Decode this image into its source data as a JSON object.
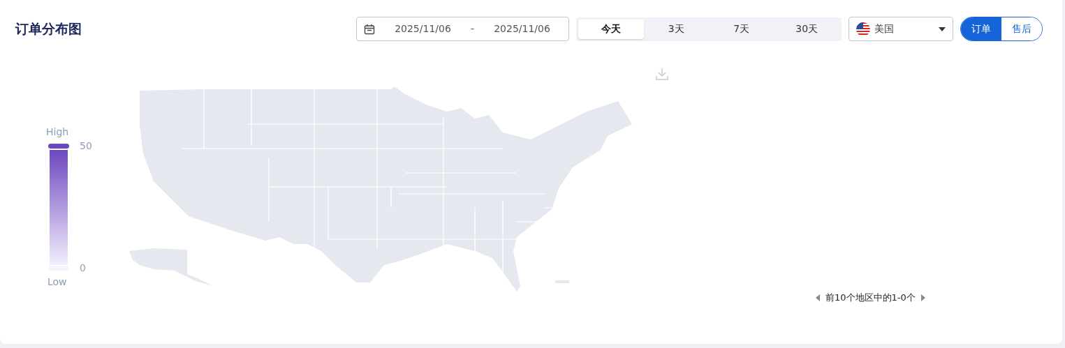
{
  "title": "订单分布图",
  "date_range": {
    "start": "2025/11/06",
    "separator": "-",
    "end": "2025/11/06"
  },
  "periods": [
    {
      "label": "今天",
      "selected": true
    },
    {
      "label": "3天",
      "selected": false
    },
    {
      "label": "7天",
      "selected": false
    },
    {
      "label": "30天",
      "selected": false
    }
  ],
  "country": {
    "label": "美国"
  },
  "modes": [
    {
      "label": "订单",
      "selected": true
    },
    {
      "label": "售后",
      "selected": false
    }
  ],
  "legend": {
    "high_label": "High",
    "max": "50",
    "min": "0",
    "low_label": "Low"
  },
  "pagination": {
    "text": "前10个地区中的1-0个"
  }
}
